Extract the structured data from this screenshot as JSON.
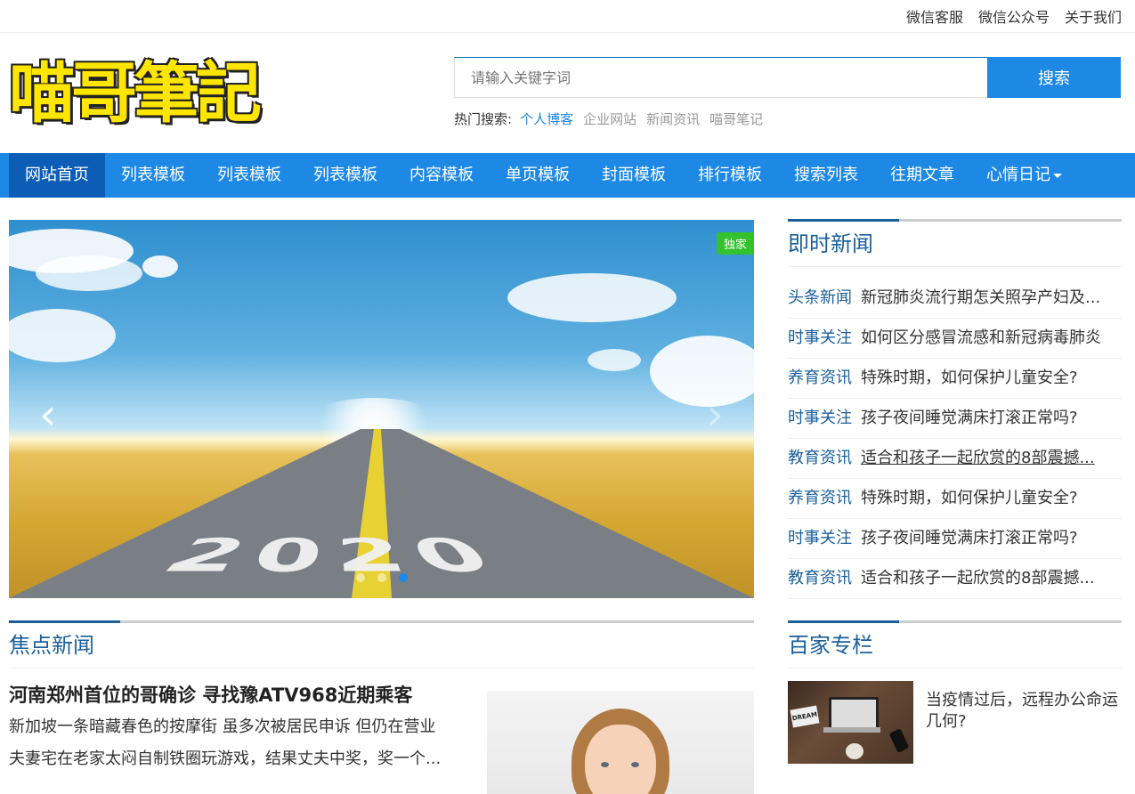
{
  "toplinks": [
    "微信客服",
    "微信公众号",
    "关于我们"
  ],
  "logo": {
    "text": "喵哥筆記",
    "color": "#ffe600"
  },
  "search": {
    "placeholder": "请输入关键字词",
    "button": "搜索"
  },
  "hot": {
    "label": "热门搜索:",
    "items": [
      "个人博客",
      "企业网站",
      "新闻资讯",
      "喵哥笔记"
    ]
  },
  "nav": {
    "items": [
      "网站首页",
      "列表模板",
      "列表模板",
      "列表模板",
      "内容模板",
      "单页模板",
      "封面模板",
      "排行模板",
      "搜索列表",
      "往期文章",
      "心情日记"
    ],
    "active_index": 0,
    "accent": "#1e88e5"
  },
  "slider": {
    "badge": "独家",
    "prev_icon": "chevron-left-icon",
    "next_icon": "chevron-right-icon",
    "dots": 3,
    "active_dot": 2,
    "image_text": "2020"
  },
  "instant": {
    "title": "即时新闻",
    "items": [
      {
        "cat": "头条新闻",
        "title": "新冠肺炎流行期怎关照孕产妇及..."
      },
      {
        "cat": "时事关注",
        "title": "如何区分感冒流感和新冠病毒肺炎"
      },
      {
        "cat": "养育资讯",
        "title": "特殊时期，如何保护儿童安全?"
      },
      {
        "cat": "时事关注",
        "title": "孩子夜间睡觉满床打滚正常吗?"
      },
      {
        "cat": "教育资讯",
        "title": "适合和孩子一起欣赏的8部震撼..."
      },
      {
        "cat": "养育资讯",
        "title": "特殊时期，如何保护儿童安全?"
      },
      {
        "cat": "时事关注",
        "title": "孩子夜间睡觉满床打滚正常吗?"
      },
      {
        "cat": "教育资讯",
        "title": "适合和孩子一起欣赏的8部震撼..."
      }
    ]
  },
  "focus": {
    "title": "焦点新闻",
    "headline": "河南郑州首位的哥确诊 寻找豫ATV968近期乘客",
    "lines": [
      "新加坡一条暗藏春色的按摩街 虽多次被居民申诉 但仍在营业",
      "夫妻宅在老家太闷自制铁圈玩游戏，结果丈夫中奖，奖一个..."
    ]
  },
  "columns": {
    "title": "百家专栏",
    "item_text": "当疫情过后，远程办公命运几何?",
    "notebook_text": "DREAM"
  }
}
